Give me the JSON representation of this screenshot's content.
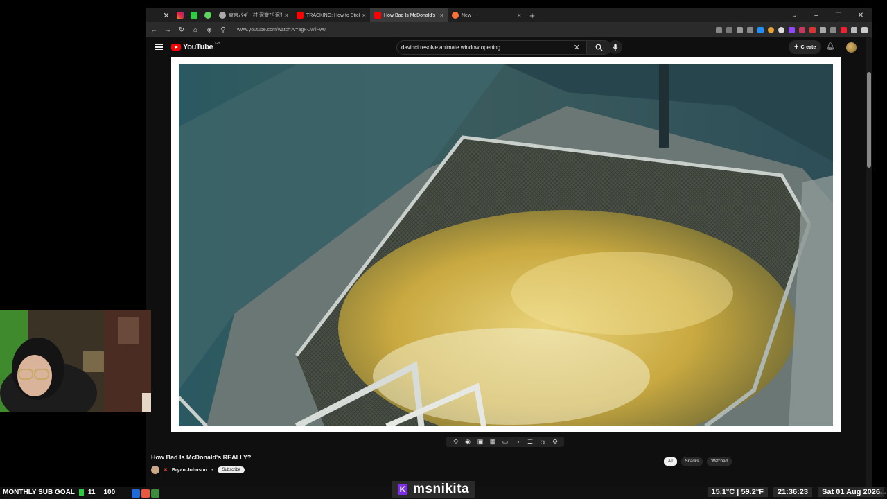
{
  "browser": {
    "tabs": [
      {
        "label": "東京バギー村 泥遊び 泥遊び - Ch",
        "icon": "globe-icon",
        "color": "#aaaaaa",
        "active": false
      },
      {
        "label": "TRACKING: How to Stick an IMAGE",
        "icon": "youtube-icon",
        "color": "#ff0000",
        "active": false
      },
      {
        "label": "How Bad Is McDonald's REALLY?",
        "icon": "youtube-icon",
        "color": "#ff0000",
        "active": true
      },
      {
        "label": "New Tab",
        "icon": "firefox-icon",
        "color": "#ff7139",
        "active": false
      }
    ],
    "url": "www.youtube.com/watch?v=agF-JwliFw0",
    "new_tab_symbol": "+",
    "close_symbol": "✕"
  },
  "youtube": {
    "logo_text": "YouTube",
    "country_code": "GB",
    "search_query": "davinci resolve animate window opening",
    "create_label": "Create",
    "video_title": "How Bad Is McDonald's REALLY?",
    "channel_name": "Bryan Johnson",
    "subscribe_label": "Subscribe",
    "chips": [
      "All",
      "Snacks",
      "Watched"
    ]
  },
  "stream": {
    "sub_goal_label": "MONTHLY SUB GOAL",
    "sub_goal_current": "11",
    "sub_goal_target": "100",
    "streamer_name": "msnikita",
    "streamer_badge": "K",
    "temperature": "15.1°C | 59.2°F",
    "time": "21:36:23",
    "date": "Sat 01 Aug 2026",
    "tiny_clock": "21:36",
    "accent": "#7b2fe0",
    "goal_color": "#2ecc40"
  }
}
